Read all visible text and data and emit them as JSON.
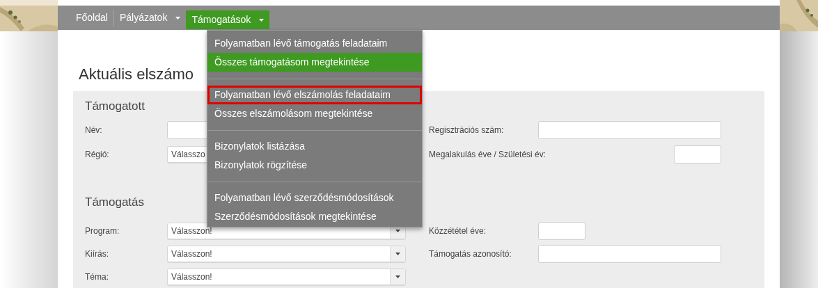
{
  "nav": {
    "items": [
      {
        "label": "Főoldal",
        "dropdown": false,
        "selected": false
      },
      {
        "label": "Pályázatok",
        "dropdown": true,
        "selected": false
      },
      {
        "label": "Támogatások",
        "dropdown": true,
        "selected": true
      }
    ]
  },
  "menu": {
    "groups": [
      [
        {
          "label": "Folyamatban lévő támogatás feladataim",
          "selected": false,
          "outlined": false
        },
        {
          "label": "Összes támogatásom megtekintése",
          "selected": true,
          "outlined": false
        }
      ],
      [
        {
          "label": "Folyamatban lévő elszámolás feladataim",
          "selected": false,
          "outlined": true
        },
        {
          "label": "Összes elszámolásom megtekintése",
          "selected": false,
          "outlined": false
        }
      ],
      [
        {
          "label": "Bizonylatok listázása",
          "selected": false,
          "outlined": false
        },
        {
          "label": "Bizonylatok rögzítése",
          "selected": false,
          "outlined": false
        }
      ],
      [
        {
          "label": "Folyamatban lévő szerződésmódosítások",
          "selected": false,
          "outlined": false
        },
        {
          "label": "Szerződésmódosítások megtekintése",
          "selected": false,
          "outlined": false
        }
      ]
    ]
  },
  "heading": "Aktuális elszámo",
  "sections": [
    {
      "title": "Támogatott",
      "rows": [
        {
          "left": {
            "label": "Név:",
            "kind": "input"
          },
          "right": {
            "label": "Regisztrációs szám:",
            "kind": "input"
          }
        },
        {
          "left": {
            "label": "Régió:",
            "kind": "covered-select",
            "value": "Válasszo"
          },
          "right": {
            "label": "Megalakulás éve / Születési év:",
            "kind": "year-input"
          }
        }
      ]
    },
    {
      "title": "Támogatás",
      "rows": [
        {
          "left": {
            "label": "Program:",
            "kind": "select",
            "value": "Válasszon!"
          },
          "right": {
            "label": "Közzététel éve:",
            "kind": "short-input"
          }
        },
        {
          "left": {
            "label": "Kiírás:",
            "kind": "select",
            "value": "Válasszon!"
          },
          "right": {
            "label": "Támogatás azonosító:",
            "kind": "input"
          }
        },
        {
          "left": {
            "label": "Téma:",
            "kind": "select",
            "value": "Válasszon!"
          }
        }
      ]
    }
  ]
}
